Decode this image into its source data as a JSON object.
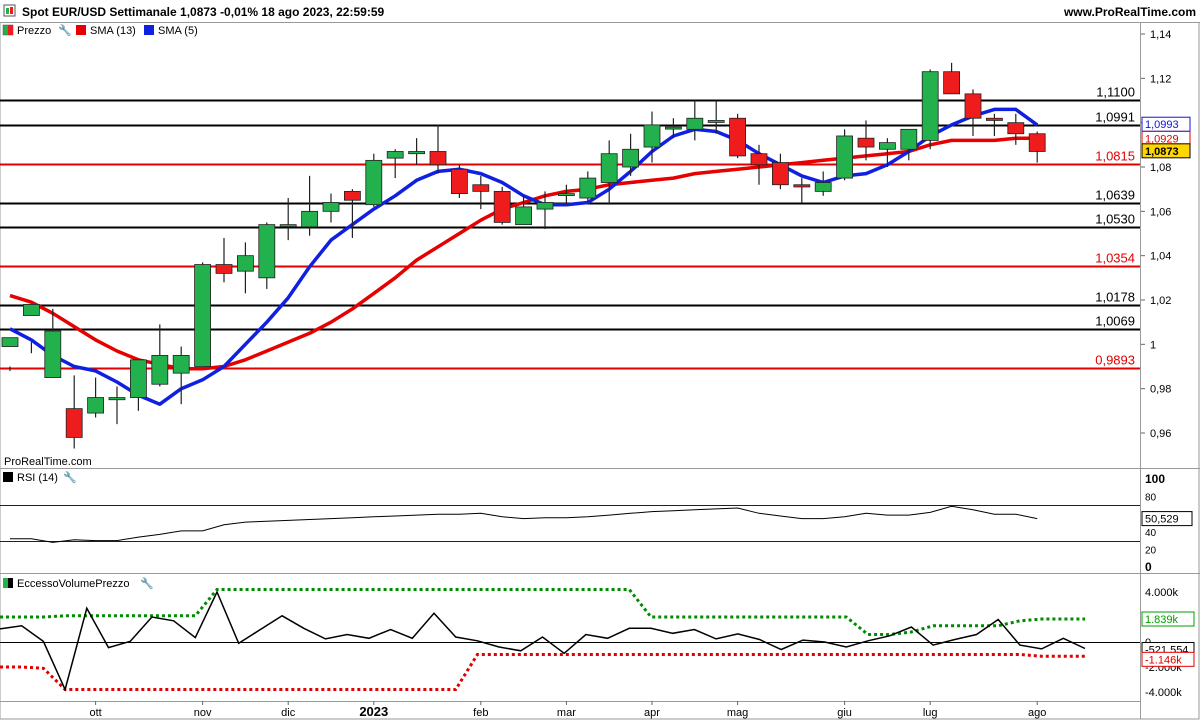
{
  "header": {
    "title": "Spot EUR/USD Settimanale 1,0873 -0,01% 18 ago 2023, 22:59:59",
    "site": "www.ProRealTime.com",
    "watermark": "ProRealTime.com"
  },
  "price_panel": {
    "legend": [
      "Prezzo",
      "SMA (13)",
      "SMA (5)"
    ],
    "y_ticks": [
      0.96,
      0.98,
      1.0,
      1.02,
      1.04,
      1.06,
      1.08,
      1.1,
      1.12,
      1.14
    ],
    "y_tick_labels": [
      "0,96",
      "0,98",
      "1",
      "1,02",
      "1,04",
      "1,06",
      "1,08",
      "1,10",
      "1,12",
      "1,14"
    ],
    "ylim": [
      0.95,
      1.14
    ],
    "levels": [
      {
        "value": 1.11,
        "label": "1,1100",
        "color": "#000000"
      },
      {
        "value": 1.0991,
        "label": "1,0991",
        "color": "#000000"
      },
      {
        "value": 1.0815,
        "label": "1,0815",
        "color": "#e00000"
      },
      {
        "value": 1.0639,
        "label": "1,0639",
        "color": "#000000"
      },
      {
        "value": 1.053,
        "label": "1,0530",
        "color": "#000000"
      },
      {
        "value": 1.0354,
        "label": "1,0354",
        "color": "#e00000"
      },
      {
        "value": 1.0178,
        "label": "1,0178",
        "color": "#000000"
      },
      {
        "value": 1.0069,
        "label": "1,0069",
        "color": "#000000"
      },
      {
        "value": 0.9893,
        "label": "0,9893",
        "color": "#e00000"
      }
    ],
    "tags": [
      {
        "value": 1.0993,
        "label": "1,0993",
        "fill": "#ffffff",
        "text": "#1010e0",
        "border": "#1010e0"
      },
      {
        "value": 1.0929,
        "label": "1,0929",
        "fill": "#ffffff",
        "text": "#e00000",
        "border": "#e00000"
      },
      {
        "value": 1.0873,
        "label": "1,0873",
        "fill": "#ffd700",
        "text": "#000000",
        "border": "#000000"
      }
    ]
  },
  "rsi_panel": {
    "legend": "RSI (14)",
    "y_tick_labels": [
      "100",
      "80",
      "60",
      "40",
      "20",
      "0"
    ],
    "y_ticks": [
      100,
      80,
      60,
      40,
      20,
      0
    ],
    "bands": [
      70,
      30
    ],
    "last_label": "50,529"
  },
  "volume_panel": {
    "legend": "EccessoVolumePrezzo",
    "y_tick_labels": [
      "4.000k",
      "2.000k",
      "0",
      "-2.000k",
      "-4.000k"
    ],
    "y_ticks": [
      4000,
      2000,
      0,
      -2000,
      -4000
    ],
    "tags": [
      {
        "value": 1839,
        "label": "1.839k",
        "color": "#00a000"
      },
      {
        "value": -521.554,
        "label": "-521.554",
        "color": "#000000"
      },
      {
        "value": -1146,
        "label": "-1.146k",
        "color": "#e00000"
      }
    ]
  },
  "x_axis": {
    "labels": [
      {
        "text": "ott",
        "idx": 4,
        "bold": false
      },
      {
        "text": "nov",
        "idx": 9,
        "bold": false
      },
      {
        "text": "dic",
        "idx": 13,
        "bold": false
      },
      {
        "text": "2023",
        "idx": 17,
        "bold": true
      },
      {
        "text": "feb",
        "idx": 22,
        "bold": false
      },
      {
        "text": "mar",
        "idx": 26,
        "bold": false
      },
      {
        "text": "apr",
        "idx": 30,
        "bold": false
      },
      {
        "text": "mag",
        "idx": 34,
        "bold": false
      },
      {
        "text": "giu",
        "idx": 39,
        "bold": false
      },
      {
        "text": "lug",
        "idx": 43,
        "bold": false
      },
      {
        "text": "ago",
        "idx": 48,
        "bold": false
      }
    ]
  },
  "colors": {
    "up": "#22b14c",
    "down": "#ee1c1c",
    "sma13": "#e60000",
    "sma5": "#1020e0",
    "vol_green": "#008c00",
    "vol_red": "#e00000"
  },
  "chart_data": {
    "type": "candlestick",
    "title": "Spot EUR/USD Settimanale",
    "ohlc": [
      [
        0.999,
        1.003,
        0.988,
        0.99
      ],
      [
        1.013,
        1.018,
        0.996,
        1.001
      ],
      [
        0.985,
        1.006,
        0.986,
        1.016
      ],
      [
        0.971,
        0.958,
        0.953,
        0.986
      ],
      [
        0.969,
        0.976,
        0.967,
        0.985
      ],
      [
        0.975,
        0.976,
        0.964,
        0.981
      ],
      [
        0.976,
        0.993,
        0.97,
        0.988
      ],
      [
        0.982,
        0.995,
        0.981,
        1.009
      ],
      [
        0.987,
        0.995,
        0.973,
        0.999
      ],
      [
        0.99,
        1.036,
        0.99,
        1.037
      ],
      [
        1.036,
        1.032,
        1.028,
        1.048
      ],
      [
        1.033,
        1.04,
        1.023,
        1.046
      ],
      [
        1.03,
        1.054,
        1.025,
        1.055
      ],
      [
        1.054,
        1.054,
        1.047,
        1.066
      ],
      [
        1.053,
        1.06,
        1.049,
        1.076
      ],
      [
        1.06,
        1.064,
        1.055,
        1.068
      ],
      [
        1.069,
        1.065,
        1.048,
        1.07
      ],
      [
        1.063,
        1.083,
        1.062,
        1.086
      ],
      [
        1.084,
        1.087,
        1.075,
        1.088
      ],
      [
        1.086,
        1.087,
        1.081,
        1.093
      ],
      [
        1.087,
        1.081,
        1.077,
        1.099
      ],
      [
        1.079,
        1.068,
        1.066,
        1.081
      ],
      [
        1.072,
        1.069,
        1.061,
        1.076
      ],
      [
        1.069,
        1.055,
        1.054,
        1.071
      ],
      [
        1.054,
        1.062,
        1.054,
        1.067
      ],
      [
        1.061,
        1.064,
        1.052,
        1.069
      ],
      [
        1.068,
        1.068,
        1.063,
        1.072
      ],
      [
        1.066,
        1.075,
        1.064,
        1.078
      ],
      [
        1.073,
        1.086,
        1.063,
        1.092
      ],
      [
        1.08,
        1.088,
        1.076,
        1.095
      ],
      [
        1.089,
        1.099,
        1.082,
        1.105
      ],
      [
        1.098,
        1.098,
        1.093,
        1.102
      ],
      [
        1.097,
        1.102,
        1.092,
        1.11
      ],
      [
        1.101,
        1.101,
        1.095,
        1.11
      ],
      [
        1.102,
        1.085,
        1.084,
        1.104
      ],
      [
        1.086,
        1.081,
        1.072,
        1.09
      ],
      [
        1.082,
        1.072,
        1.07,
        1.086
      ],
      [
        1.072,
        1.071,
        1.064,
        1.075
      ],
      [
        1.069,
        1.073,
        1.067,
        1.078
      ],
      [
        1.075,
        1.094,
        1.074,
        1.097
      ],
      [
        1.093,
        1.089,
        1.083,
        1.101
      ],
      [
        1.088,
        1.091,
        1.08,
        1.093
      ],
      [
        1.088,
        1.097,
        1.083,
        1.097
      ],
      [
        1.092,
        1.123,
        1.088,
        1.124
      ],
      [
        1.123,
        1.113,
        1.113,
        1.127
      ],
      [
        1.113,
        1.102,
        1.094,
        1.115
      ],
      [
        1.102,
        1.101,
        1.094,
        1.104
      ],
      [
        1.1,
        1.095,
        1.09,
        1.104
      ],
      [
        1.095,
        1.087,
        1.082,
        1.096
      ]
    ],
    "sma13": [
      1.022,
      1.019,
      1.014,
      1.008,
      1.002,
      0.997,
      0.993,
      0.991,
      0.989,
      0.989,
      0.99,
      0.993,
      0.997,
      1.001,
      1.005,
      1.01,
      1.016,
      1.023,
      1.03,
      1.038,
      1.044,
      1.05,
      1.056,
      1.061,
      1.064,
      1.067,
      1.069,
      1.07,
      1.072,
      1.073,
      1.074,
      1.075,
      1.077,
      1.078,
      1.079,
      1.08,
      1.081,
      1.082,
      1.083,
      1.084,
      1.085,
      1.086,
      1.087,
      1.09,
      1.092,
      1.092,
      1.092,
      1.093,
      1.093
    ],
    "sma5": [
      1.007,
      1.002,
      0.995,
      0.99,
      0.988,
      0.983,
      0.977,
      0.973,
      0.98,
      0.984,
      0.99,
      1.0,
      1.01,
      1.021,
      1.035,
      1.047,
      1.054,
      1.061,
      1.067,
      1.074,
      1.078,
      1.079,
      1.077,
      1.073,
      1.067,
      1.063,
      1.063,
      1.064,
      1.07,
      1.078,
      1.087,
      1.094,
      1.097,
      1.096,
      1.092,
      1.086,
      1.081,
      1.076,
      1.073,
      1.076,
      1.077,
      1.081,
      1.087,
      1.094,
      1.099,
      1.103,
      1.106,
      1.106,
      1.099
    ],
    "rsi": [
      32,
      32,
      28,
      31,
      30,
      30,
      34,
      37,
      41,
      41,
      48,
      51,
      52,
      53,
      54,
      55,
      56,
      57,
      58,
      59,
      60,
      60,
      61,
      57,
      55,
      56,
      56,
      57,
      59,
      61,
      63,
      64,
      65,
      66,
      67,
      61,
      58,
      55,
      55,
      57,
      61,
      59,
      59,
      62,
      69,
      65,
      60,
      60,
      55
    ],
    "volume_excess": [
      1050,
      1300,
      50,
      -3800,
      2700,
      -450,
      50,
      2000,
      1700,
      350,
      4000,
      -100,
      1000,
      2100,
      1100,
      250,
      600,
      300,
      1000,
      300,
      2300,
      400,
      100,
      -400,
      -700,
      400,
      -900,
      600,
      300,
      1100,
      1100,
      700,
      1000,
      250,
      650,
      200,
      -600,
      150,
      0,
      -400,
      100,
      500,
      1200,
      -250,
      200,
      600,
      1800,
      -250,
      -550,
      300,
      -522
    ],
    "volume_upper": [
      2000,
      2000,
      2000,
      2100,
      2100,
      2100,
      2100,
      2100,
      2100,
      2100,
      4200,
      4200,
      4200,
      4200,
      4200,
      4200,
      4200,
      4200,
      4200,
      4200,
      4200,
      4200,
      4200,
      4200,
      4200,
      4200,
      4200,
      4200,
      4200,
      4200,
      2000,
      2000,
      2000,
      2000,
      2000,
      2000,
      2000,
      2000,
      2000,
      2000,
      600,
      600,
      800,
      1300,
      1300,
      1300,
      1300,
      1700,
      1839,
      1839,
      1839
    ],
    "volume_lower": [
      -2000,
      -2000,
      -2100,
      -3800,
      -3800,
      -3800,
      -3800,
      -3800,
      -3800,
      -3800,
      -3800,
      -3800,
      -3800,
      -3800,
      -3800,
      -3800,
      -3800,
      -3800,
      -3800,
      -3800,
      -3800,
      -3800,
      -1000,
      -1000,
      -1000,
      -1000,
      -1000,
      -1000,
      -1000,
      -1000,
      -1000,
      -1000,
      -1000,
      -1000,
      -1000,
      -1000,
      -1000,
      -1000,
      -1000,
      -1000,
      -1000,
      -1000,
      -1000,
      -1000,
      -1000,
      -1000,
      -1000,
      -1000,
      -1146,
      -1146,
      -1146
    ]
  }
}
